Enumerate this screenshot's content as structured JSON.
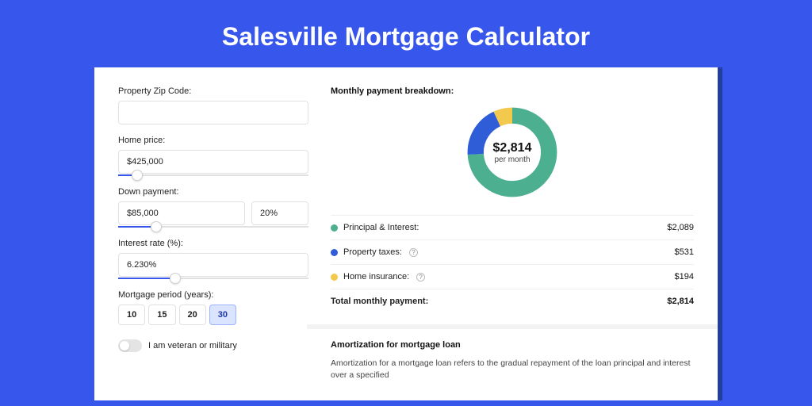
{
  "title": "Salesville Mortgage Calculator",
  "left": {
    "zip_label": "Property Zip Code:",
    "zip_value": "",
    "home_price_label": "Home price:",
    "home_price_value": "$425,000",
    "home_price_slider_pct": 10,
    "down_payment_label": "Down payment:",
    "down_payment_value": "$85,000",
    "down_payment_pct_value": "20%",
    "down_payment_slider_pct": 20,
    "interest_label": "Interest rate (%):",
    "interest_value": "6.230%",
    "interest_slider_pct": 30,
    "period_label": "Mortgage period (years):",
    "periods": [
      "10",
      "15",
      "20",
      "30"
    ],
    "period_active": "30",
    "veteran_label": "I am veteran or military"
  },
  "right": {
    "breakdown_heading": "Monthly payment breakdown:",
    "donut_total": "$2,814",
    "donut_sub": "per month",
    "segments": {
      "principal_interest": {
        "label": "Principal & Interest:",
        "value": "$2,089",
        "color": "#4caf8f",
        "pct": 74
      },
      "property_taxes": {
        "label": "Property taxes:",
        "value": "$531",
        "color": "#2f5dd8",
        "pct": 19
      },
      "home_insurance": {
        "label": "Home insurance:",
        "value": "$194",
        "color": "#f2c94c",
        "pct": 7
      }
    },
    "total_label": "Total monthly payment:",
    "total_value": "$2,814",
    "amort_heading": "Amortization for mortgage loan",
    "amort_text": "Amortization for a mortgage loan refers to the gradual repayment of the loan principal and interest over a specified"
  },
  "chart_data": {
    "type": "pie",
    "title": "Monthly payment breakdown",
    "categories": [
      "Principal & Interest",
      "Property taxes",
      "Home insurance"
    ],
    "values": [
      2089,
      531,
      194
    ],
    "colors": [
      "#4caf8f",
      "#2f5dd8",
      "#f2c94c"
    ],
    "total": 2814,
    "center_label": "$2,814 per month"
  }
}
